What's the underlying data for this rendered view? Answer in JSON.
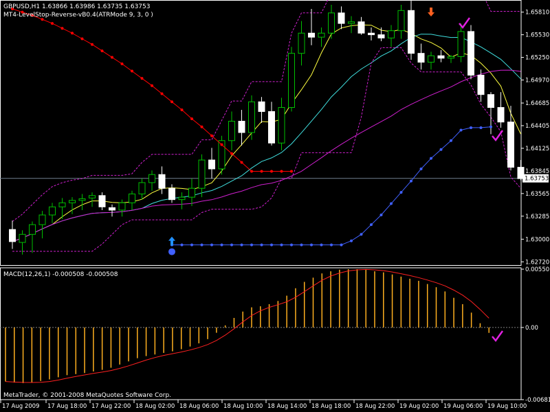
{
  "header": {
    "symbol_line": "GBPUSD,H1  1.63866 1.63986 1.63735 1.63753",
    "indicator_line": "MT4-LevelStop-Reverse-vB0.4(ATRMode 9, 3, 0 )"
  },
  "macd": {
    "label": "MACD(12,26,1) -0.000508 -0.000508",
    "levels": [
      "0.00550",
      "0.00",
      "-0.00681"
    ]
  },
  "footer": {
    "copyright": "MetaTrader, © 2001-2008 MetaQuotes Software Corp."
  },
  "colors": {
    "background": "#000000",
    "axis": "#ffffff",
    "bull": "#00c000",
    "bear": "#ffffff",
    "stop_red": "#ff0000",
    "stop_blue": "#4060ff",
    "ma_yellow": "#ffff40",
    "ma_cyan": "#40e0e0",
    "ma_magenta": "#d020d0",
    "envelope": "#d020d0",
    "macd_hist": "#ffb020",
    "macd_signal": "#ff2020",
    "check": "#e020e0"
  },
  "chart_data": [
    {
      "type": "candlestick",
      "symbol": "GBPUSD",
      "timeframe": "H1",
      "price_axis_labels": [
        "1.65810",
        "1.65530",
        "1.65250",
        "1.64970",
        "1.64685",
        "1.64405",
        "1.64125",
        "1.63845",
        "1.63565",
        "1.63285",
        "1.63000",
        "1.62720"
      ],
      "time_axis_labels": [
        "17 Aug 2009",
        "17 Aug 18:00",
        "17 Aug 22:00",
        "18 Aug 02:00",
        "18 Aug 06:00",
        "18 Aug 10:00",
        "18 Aug 14:00",
        "18 Aug 18:00",
        "18 Aug 22:00",
        "19 Aug 02:00",
        "19 Aug 06:00",
        "19 Aug 10:00"
      ],
      "current_price": "1.63753",
      "ylim": [
        1.6268,
        1.6596
      ],
      "candles": [
        [
          1.6312,
          1.6323,
          1.6288,
          1.6297
        ],
        [
          1.6296,
          1.6311,
          1.6281,
          1.6306
        ],
        [
          1.6306,
          1.6322,
          1.6283,
          1.6318
        ],
        [
          1.6318,
          1.6335,
          1.6301,
          1.633
        ],
        [
          1.633,
          1.6345,
          1.632,
          1.634
        ],
        [
          1.634,
          1.6351,
          1.6325,
          1.6345
        ],
        [
          1.6345,
          1.6352,
          1.6331,
          1.6348
        ],
        [
          1.6348,
          1.6356,
          1.6336,
          1.635
        ],
        [
          1.6351,
          1.6358,
          1.634,
          1.6354
        ],
        [
          1.6354,
          1.6358,
          1.6336,
          1.634
        ],
        [
          1.6339,
          1.6343,
          1.6328,
          1.6336
        ],
        [
          1.6336,
          1.6349,
          1.6328,
          1.6345
        ],
        [
          1.6345,
          1.636,
          1.6336,
          1.6356
        ],
        [
          1.6356,
          1.6375,
          1.6349,
          1.637
        ],
        [
          1.637,
          1.6385,
          1.636,
          1.638
        ],
        [
          1.638,
          1.639,
          1.6356,
          1.6363
        ],
        [
          1.6363,
          1.6368,
          1.6345,
          1.6349
        ],
        [
          1.6349,
          1.6358,
          1.6337,
          1.6352
        ],
        [
          1.6352,
          1.6375,
          1.6341,
          1.6363
        ],
        [
          1.6363,
          1.6405,
          1.6352,
          1.6398
        ],
        [
          1.6398,
          1.6413,
          1.6375,
          1.6387
        ],
        [
          1.6387,
          1.6428,
          1.638,
          1.6422
        ],
        [
          1.6422,
          1.6458,
          1.641,
          1.6446
        ],
        [
          1.6446,
          1.646,
          1.6416,
          1.6432
        ],
        [
          1.6432,
          1.6478,
          1.6423,
          1.647
        ],
        [
          1.647,
          1.6476,
          1.6444,
          1.6458
        ],
        [
          1.6458,
          1.647,
          1.6416,
          1.6419
        ],
        [
          1.6419,
          1.6475,
          1.641,
          1.6463
        ],
        [
          1.6463,
          1.6538,
          1.6458,
          1.653
        ],
        [
          1.653,
          1.657,
          1.6515,
          1.6555
        ],
        [
          1.6555,
          1.6585,
          1.654,
          1.655
        ],
        [
          1.655,
          1.6562,
          1.6538,
          1.6555
        ],
        [
          1.6555,
          1.659,
          1.6548,
          1.658
        ],
        [
          1.658,
          1.6588,
          1.656,
          1.6567
        ],
        [
          1.6567,
          1.6576,
          1.6555,
          1.6569
        ],
        [
          1.6569,
          1.6575,
          1.6553,
          1.6555
        ],
        [
          1.6555,
          1.6562,
          1.6546,
          1.6553
        ],
        [
          1.6553,
          1.6562,
          1.6545,
          1.6549
        ],
        [
          1.6549,
          1.6565,
          1.6538,
          1.6558
        ],
        [
          1.6558,
          1.659,
          1.6548,
          1.6583
        ],
        [
          1.6583,
          1.6598,
          1.6522,
          1.653
        ],
        [
          1.653,
          1.6542,
          1.651,
          1.6519
        ],
        [
          1.6519,
          1.6532,
          1.651,
          1.6527
        ],
        [
          1.6527,
          1.6534,
          1.6519,
          1.6524
        ],
        [
          1.6524,
          1.6528,
          1.6518,
          1.6526
        ],
        [
          1.6526,
          1.6567,
          1.6519,
          1.6557
        ],
        [
          1.6557,
          1.6565,
          1.6498,
          1.6503
        ],
        [
          1.6503,
          1.651,
          1.647,
          1.6479
        ],
        [
          1.6479,
          1.6482,
          1.643,
          1.6463
        ],
        [
          1.6463,
          1.6482,
          1.6438,
          1.6445
        ],
        [
          1.6445,
          1.6465,
          1.6385,
          1.6389
        ],
        [
          1.6389,
          1.6398,
          1.6373,
          1.6375
        ]
      ],
      "series": [
        {
          "name": "MT4-LevelStop-Reverse",
          "color": "#ff0000",
          "values": [
            1.6585,
            1.6581,
            1.6577,
            1.6572,
            1.6567,
            1.6561,
            1.6555,
            1.6548,
            1.6541,
            1.6533,
            1.6525,
            1.6517,
            1.6508,
            1.6499,
            1.649,
            1.648,
            1.647,
            1.646,
            1.6449,
            1.6439,
            1.6428,
            1.6417,
            1.6406,
            1.6395,
            1.6384,
            1.6384,
            1.6384,
            1.6384,
            1.6384
          ]
        },
        {
          "name": "MT4-LevelStop-Reverse",
          "color": "#4060ff",
          "values": [
            1.6293,
            1.6293,
            1.6293,
            1.6293,
            1.6293,
            1.6293,
            1.6293,
            1.6293,
            1.6293,
            1.6293,
            1.6293,
            1.6293,
            1.6293,
            1.6293,
            1.6293,
            1.6293,
            1.6293,
            1.6293,
            1.6298,
            1.6306,
            1.6318,
            1.633,
            1.6344,
            1.6358,
            1.6372,
            1.6387,
            1.64,
            1.6411,
            1.6422,
            1.6435,
            1.6438,
            1.6438,
            1.6439
          ]
        }
      ]
    },
    {
      "type": "bar",
      "name": "MACD(12,26,1)",
      "ylim": [
        -0.00681,
        0.0055
      ],
      "values": [
        -0.0051,
        -0.0052,
        -0.00525,
        -0.0052,
        -0.00505,
        -0.0049,
        -0.0047,
        -0.0045,
        -0.0044,
        -0.0043,
        -0.00415,
        -0.004,
        -0.0038,
        -0.0035,
        -0.0032,
        -0.0029,
        -0.0027,
        -0.00255,
        -0.0024,
        -0.00225,
        -0.00205,
        -0.0018,
        -0.0015,
        -0.0011,
        -0.0005,
        0.0002,
        0.0009,
        0.0015,
        0.0019,
        0.002,
        0.0022,
        0.0025,
        0.003,
        0.0037,
        0.0043,
        0.0047,
        0.0051,
        0.0053,
        0.00545,
        0.0055,
        0.0055,
        0.00545,
        0.0053,
        0.0052,
        0.005,
        0.0048,
        0.0046,
        0.0044,
        0.0041,
        0.0038,
        0.0034,
        0.0028,
        0.0022,
        0.0014,
        0.0004,
        -0.00051
      ]
    }
  ]
}
